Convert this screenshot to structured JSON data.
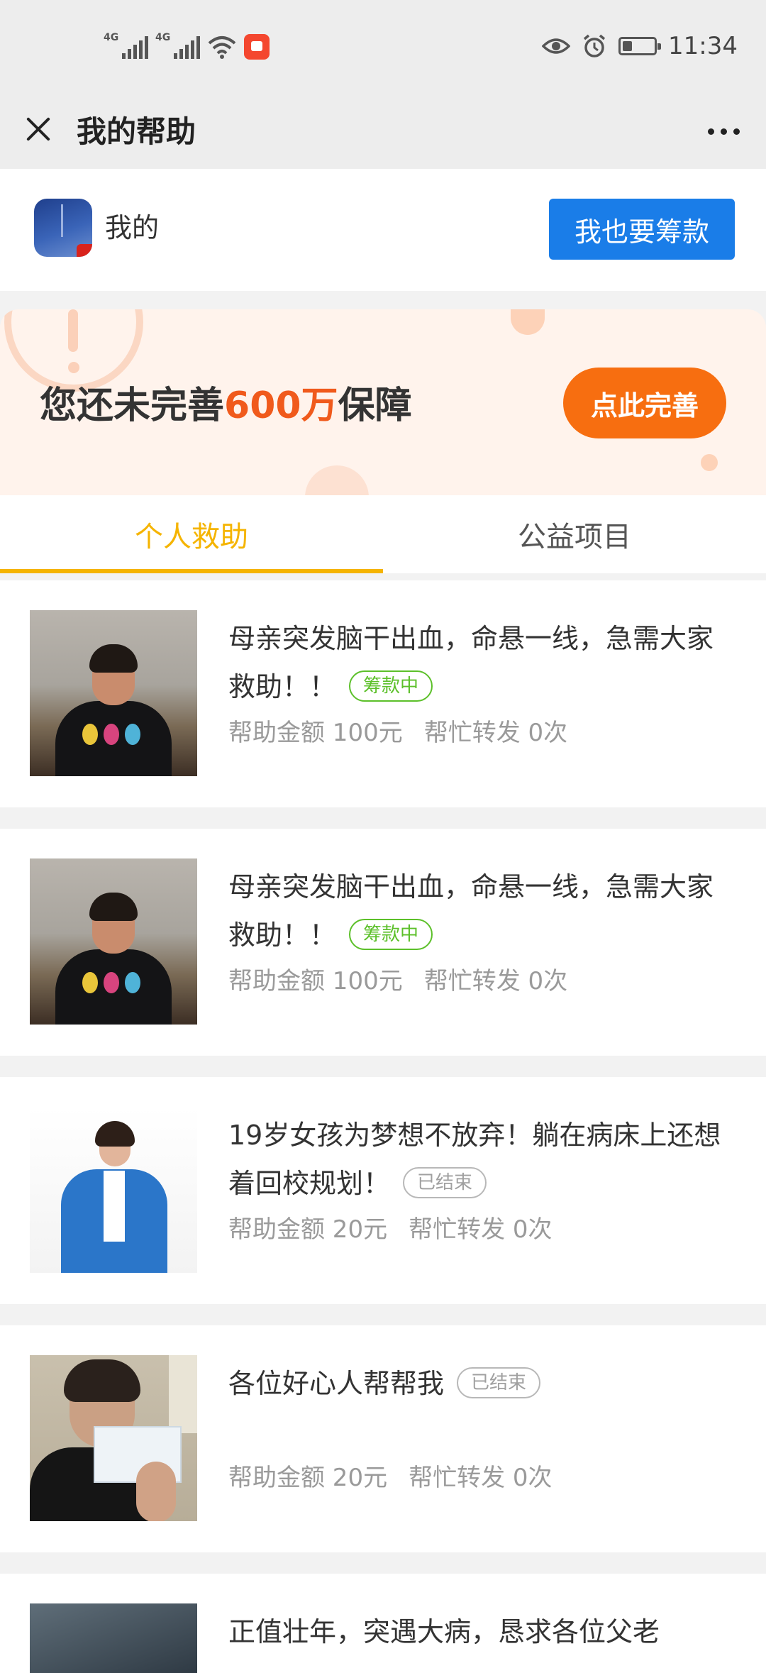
{
  "status_bar": {
    "network_1": "4G",
    "network_2": "4G",
    "time": "11:34",
    "battery_level": 0.3
  },
  "header": {
    "title": "我的帮助"
  },
  "user": {
    "name": "我的",
    "raise_button": "我也要筹款"
  },
  "banner": {
    "text_before": "您还未完善",
    "amount": "600万",
    "text_after": "保障",
    "button": "点此完善"
  },
  "tabs": [
    {
      "label": "个人救助",
      "active": true
    },
    {
      "label": "公益项目",
      "active": false
    }
  ],
  "cases": [
    {
      "title": "母亲突发脑干出血，命悬一线，急需大家救助！！",
      "status": "筹款中",
      "status_color": "#5cc02a",
      "amount": "帮助金额 100元",
      "shares": "帮忙转发 0次"
    },
    {
      "title": "母亲突发脑干出血，命悬一线，急需大家救助！！",
      "status": "筹款中",
      "status_color": "#5cc02a",
      "amount": "帮助金额 100元",
      "shares": "帮忙转发 0次"
    },
    {
      "title": "19岁女孩为梦想不放弃！躺在病床上还想着回校规划！",
      "status": "已结束",
      "status_color": "#a0a0a0",
      "amount": "帮助金额 20元",
      "shares": "帮忙转发 0次"
    },
    {
      "title": "各位好心人帮帮我",
      "status": "已结束",
      "status_color": "#a0a0a0",
      "amount": "帮助金额 20元",
      "shares": "帮忙转发 0次"
    },
    {
      "title": "正值壮年，突遇大病，恳求各位父老"
    }
  ],
  "colors": {
    "accent_blue": "#1a7de8",
    "tab_active": "#f5b400",
    "banner_orange": "#f76e10"
  }
}
